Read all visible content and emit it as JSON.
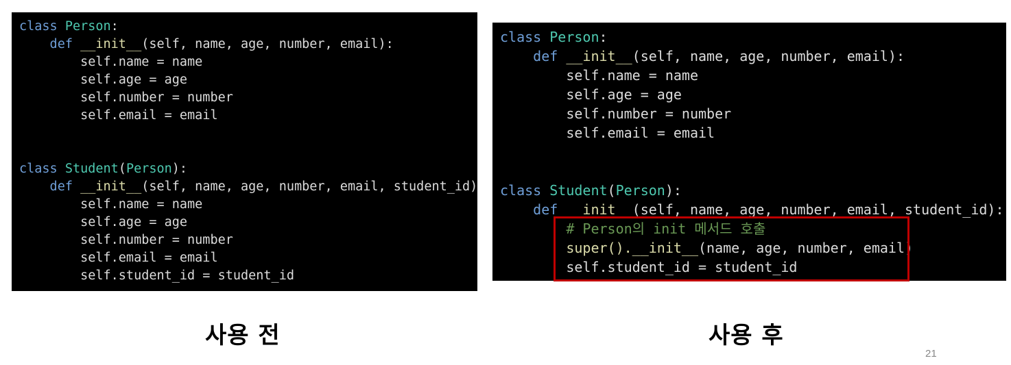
{
  "before": {
    "caption": "사용 전",
    "code": [
      [
        {
          "t": "class ",
          "c": "kw"
        },
        {
          "t": "Person",
          "c": "cls"
        },
        {
          "t": ":",
          "c": "txt"
        }
      ],
      [
        {
          "t": "    def ",
          "c": "kw"
        },
        {
          "t": "__init__",
          "c": "fn"
        },
        {
          "t": "(self, name, age, number, email):",
          "c": "txt"
        }
      ],
      [
        {
          "t": "        self.name = name",
          "c": "txt"
        }
      ],
      [
        {
          "t": "        self.age = age",
          "c": "txt"
        }
      ],
      [
        {
          "t": "        self.number = number",
          "c": "txt"
        }
      ],
      [
        {
          "t": "        self.email = email",
          "c": "txt"
        }
      ],
      [],
      [],
      [
        {
          "t": "class ",
          "c": "kw"
        },
        {
          "t": "Student",
          "c": "cls"
        },
        {
          "t": "(",
          "c": "txt"
        },
        {
          "t": "Person",
          "c": "cls"
        },
        {
          "t": "):",
          "c": "txt"
        }
      ],
      [
        {
          "t": "    def ",
          "c": "kw"
        },
        {
          "t": "__init__",
          "c": "fn"
        },
        {
          "t": "(self, name, age, number, email, student_id):",
          "c": "txt"
        }
      ],
      [
        {
          "t": "        self.name = name",
          "c": "txt"
        }
      ],
      [
        {
          "t": "        self.age = age",
          "c": "txt"
        }
      ],
      [
        {
          "t": "        self.number = number",
          "c": "txt"
        }
      ],
      [
        {
          "t": "        self.email = email",
          "c": "txt"
        }
      ],
      [
        {
          "t": "        self.student_id = student_id",
          "c": "txt"
        }
      ]
    ]
  },
  "after": {
    "caption": "사용 후",
    "code": [
      [
        {
          "t": "class ",
          "c": "kw"
        },
        {
          "t": "Person",
          "c": "cls"
        },
        {
          "t": ":",
          "c": "txt"
        }
      ],
      [
        {
          "t": "    def ",
          "c": "kw"
        },
        {
          "t": "__init__",
          "c": "fn"
        },
        {
          "t": "(self, name, age, number, email):",
          "c": "txt"
        }
      ],
      [
        {
          "t": "        self.name = name",
          "c": "txt"
        }
      ],
      [
        {
          "t": "        self.age = age",
          "c": "txt"
        }
      ],
      [
        {
          "t": "        self.number = number",
          "c": "txt"
        }
      ],
      [
        {
          "t": "        self.email = email",
          "c": "txt"
        }
      ],
      [],
      [],
      [
        {
          "t": "class ",
          "c": "kw"
        },
        {
          "t": "Student",
          "c": "cls"
        },
        {
          "t": "(",
          "c": "txt"
        },
        {
          "t": "Person",
          "c": "cls"
        },
        {
          "t": "):",
          "c": "txt"
        }
      ],
      [
        {
          "t": "    def ",
          "c": "kw"
        },
        {
          "t": "__init__",
          "c": "fn"
        },
        {
          "t": "(self, name, age, number, email, student_id):",
          "c": "txt"
        }
      ],
      [
        {
          "t": "        # Person의 init 메서드 호출",
          "c": "cmt"
        }
      ],
      [
        {
          "t": "        super().",
          "c": "fn"
        },
        {
          "t": "__init__",
          "c": "fn"
        },
        {
          "t": "(name, age, number, email)",
          "c": "txt"
        }
      ],
      [
        {
          "t": "        self.student_id = student_id",
          "c": "txt"
        }
      ]
    ]
  },
  "page_number": "21",
  "colors": {
    "panel_bg": "#000000",
    "keyword": "#6f9fd8",
    "class_name": "#4ec9b0",
    "function": "#dcdcaa",
    "comment": "#6a9955",
    "text": "#dcdcdc",
    "highlight_border": "#c00000"
  }
}
